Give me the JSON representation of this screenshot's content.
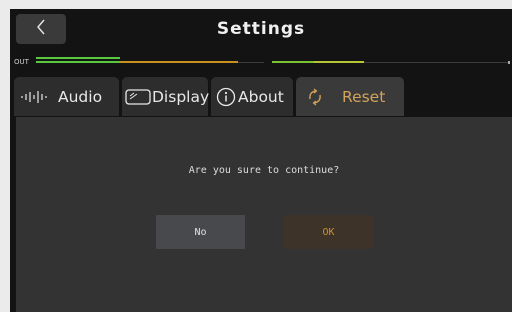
{
  "header": {
    "title": "Settings",
    "back_icon": "chevron-left-icon"
  },
  "meter": {
    "label": "OUT",
    "colors": {
      "green": "#58c93e",
      "orange": "#c8901c",
      "yellow": "#b7c534"
    }
  },
  "tabs": [
    {
      "label": "Audio",
      "icon": "waveform-icon",
      "active": false
    },
    {
      "label": "Display",
      "icon": "display-icon",
      "active": false
    },
    {
      "label": "About",
      "icon": "info-icon",
      "active": false
    },
    {
      "label": "Reset",
      "icon": "reset-icon",
      "active": true
    }
  ],
  "dialog": {
    "question": "Are you sure to continue?",
    "no_label": "No",
    "ok_label": "OK"
  },
  "colors": {
    "accent": "#d2a35a",
    "background": "#131313",
    "panel": "#333333"
  }
}
